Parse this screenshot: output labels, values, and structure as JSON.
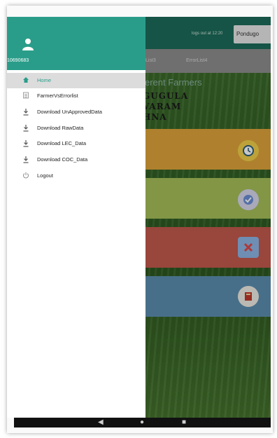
{
  "colors": {
    "drawer_header": "#2a9d8a",
    "active_accent": "#2a9d8a",
    "app_header": "#1c6c5a"
  },
  "app": {
    "logs_text": "logs out at 12:20",
    "place_button": "Pondugo"
  },
  "tabs": [
    {
      "label": "List3"
    },
    {
      "label": "ErrorList4"
    }
  ],
  "main": {
    "title": "fferent Farmers",
    "farmer_lines": [
      "GUGULA",
      "VARAM",
      "HNA"
    ]
  },
  "cards": [
    {
      "color": "#e0a63b",
      "icon": "clock-icon"
    },
    {
      "color": "#a7c05a",
      "icon": "check-icon"
    },
    {
      "color": "#c45a4e",
      "icon": "cross-icon"
    },
    {
      "color": "#5d8fb0",
      "icon": "book-icon"
    }
  ],
  "drawer": {
    "user_id": "10690683",
    "items": [
      {
        "label": "Home",
        "icon": "home-icon",
        "active": true
      },
      {
        "label": "FarmerVsErrorlist",
        "icon": "list-icon",
        "active": false
      },
      {
        "label": "Download UnApprovedData",
        "icon": "download-icon",
        "active": false
      },
      {
        "label": "Download RawData",
        "icon": "download-icon",
        "active": false
      },
      {
        "label": "Download LEC_Data",
        "icon": "download-icon",
        "active": false
      },
      {
        "label": "Download COC_Data",
        "icon": "download-icon",
        "active": false
      },
      {
        "label": "Logout",
        "icon": "power-icon",
        "active": false
      }
    ]
  }
}
